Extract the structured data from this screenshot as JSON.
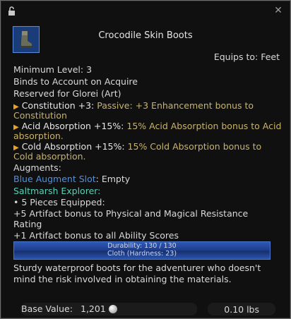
{
  "item": {
    "name": "Crocodile Skin Boots",
    "equips_to": "Equips to: Feet",
    "minimum_level": "Minimum Level: 3",
    "binds": "Binds to Account on Acquire",
    "reserved": "Reserved for Glorei (Art)"
  },
  "effects": [
    {
      "name": "Constitution +3:",
      "desc_1": " Passive: +3 Enhancement bonus to",
      "desc_2": "Constitution"
    },
    {
      "name": "Acid Absorption +15%:",
      "desc_1": " 15% Acid Absorption bonus to Acid",
      "desc_2": "absorption."
    },
    {
      "name": "Cold Absorption +15%:",
      "desc_1": " 15% Cold Absorption bonus to",
      "desc_2": "Cold absorption."
    }
  ],
  "augments": {
    "label": "Augments:",
    "slot": "Blue Augment Slot",
    "slot_value": ": Empty"
  },
  "set": {
    "name": "Saltmarsh Explorer:",
    "pieces": "• 5 Pieces Equipped:",
    "bonus_1a": "+5 Artifact bonus to Physical and Magical Resistance",
    "bonus_1b": "Rating",
    "bonus_2": "+1 Artifact bonus to all Ability Scores"
  },
  "durability": {
    "line_1": "Durability: 130 / 130",
    "line_2": "Cloth (Hardness: 23)"
  },
  "description": "Sturdy waterproof boots for the adventurer who doesn't mind the risk involved in obtaining the materials.",
  "footer": {
    "base_label": "Base Value:",
    "base_value": "1,201",
    "weight": "0.10 lbs"
  },
  "icons": {
    "lock": "lock-icon",
    "close": "close-icon",
    "item": "boots-icon",
    "coin": "silver-coin-icon"
  },
  "colors": {
    "effect_gold": "#c9b36a",
    "augment_blue": "#4f8fe6",
    "set_teal": "#58d1b5",
    "bullet_orange": "#e8a523"
  }
}
